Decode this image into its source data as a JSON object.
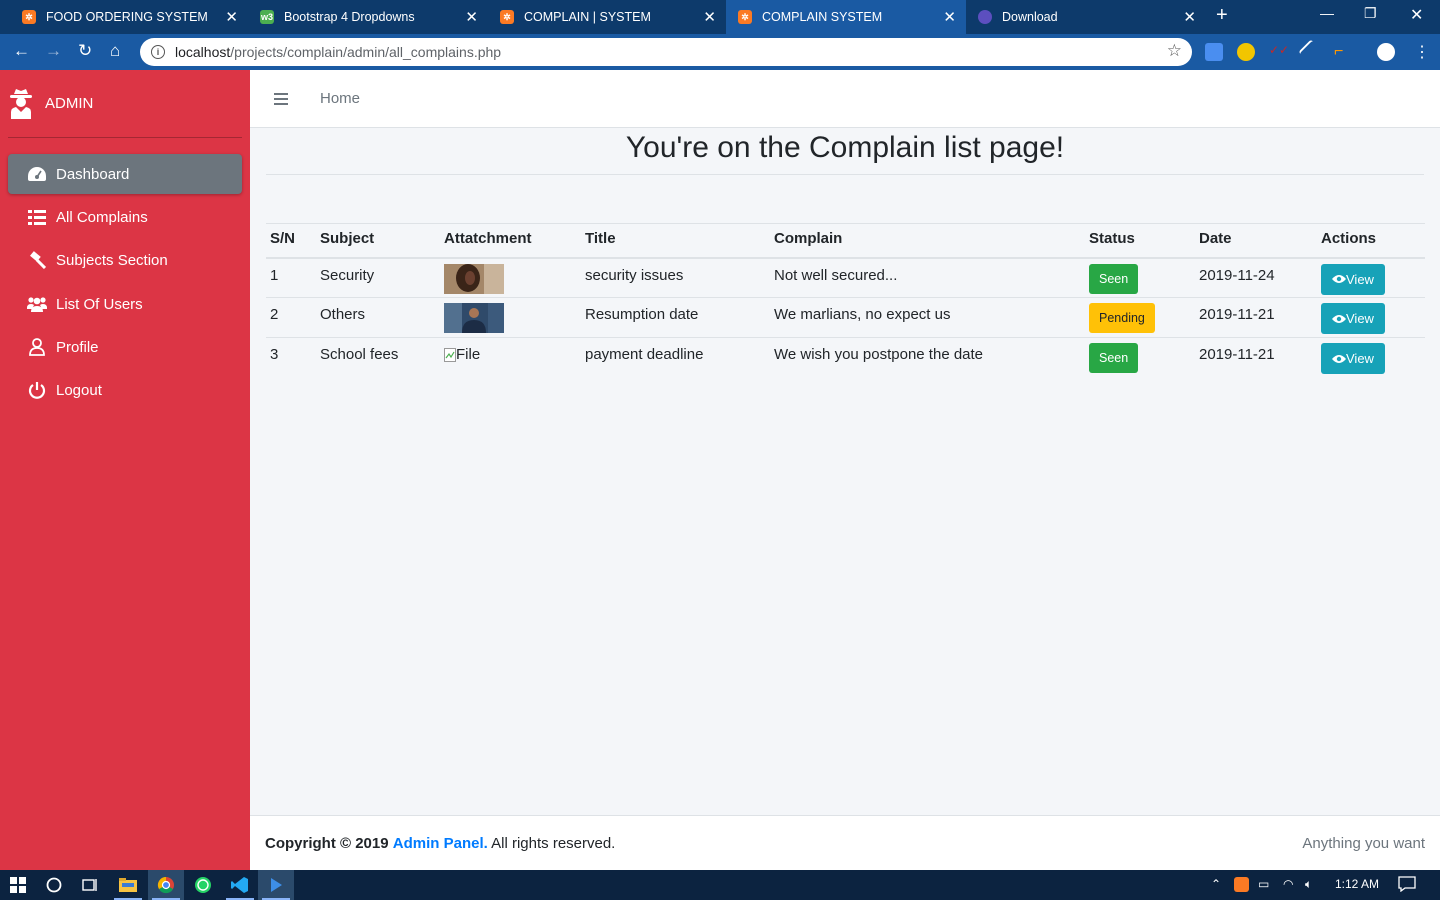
{
  "browser": {
    "tabs": [
      {
        "title": "FOOD ORDERING SYSTEM",
        "favicon": "xampp-icon",
        "active": false
      },
      {
        "title": "Bootstrap 4 Dropdowns",
        "favicon": "w3-icon",
        "active": false
      },
      {
        "title": "COMPLAIN | SYSTEM",
        "favicon": "xampp-icon",
        "active": false
      },
      {
        "title": "COMPLAIN SYSTEM",
        "favicon": "xampp-icon",
        "active": true
      },
      {
        "title": "Download",
        "favicon": "globe-icon",
        "active": false
      }
    ],
    "url_host": "localhost",
    "url_path": "/projects/complain/admin/all_complains.php"
  },
  "sidebar": {
    "brand": "ADMIN",
    "items": [
      {
        "label": "Dashboard",
        "icon": "tachometer-icon",
        "active": true
      },
      {
        "label": "All Complains",
        "icon": "list-icon",
        "active": false
      },
      {
        "label": "Subjects Section",
        "icon": "gavel-icon",
        "active": false
      },
      {
        "label": "List Of Users",
        "icon": "users-icon",
        "active": false
      },
      {
        "label": "Profile",
        "icon": "user-icon",
        "active": false
      },
      {
        "label": "Logout",
        "icon": "power-icon",
        "active": false
      }
    ]
  },
  "topnav": {
    "home": "Home"
  },
  "page": {
    "title": "You're on the Complain list page!"
  },
  "table": {
    "headers": [
      "S/N",
      "Subject",
      "Attatchment",
      "Title",
      "Complain",
      "Status",
      "Date",
      "Actions"
    ],
    "rows": [
      {
        "sn": "1",
        "subject": "Security",
        "attachment": "image",
        "title": "security issues",
        "complain": "Not well secured...",
        "status": "Seen",
        "date": "2019-11-24",
        "action": "View"
      },
      {
        "sn": "2",
        "subject": "Others",
        "attachment": "image",
        "title": "Resumption date",
        "complain": "We marlians, no expect us",
        "status": "Pending",
        "date": "2019-11-21",
        "action": "View"
      },
      {
        "sn": "3",
        "subject": "School fees",
        "attachment": "File",
        "title": "payment deadline",
        "complain": "We wish you postpone the date",
        "status": "Seen",
        "date": "2019-11-21",
        "action": "View"
      }
    ]
  },
  "footer": {
    "copyright_prefix": "Copyright © 2019",
    "brand": "Admin Panel.",
    "suffix": "All rights reserved.",
    "right": "Anything you want"
  },
  "taskbar": {
    "time": "1:12 AM"
  },
  "colors": {
    "sidebar": "#dc3545",
    "active_nav": "#6c757d",
    "seen": "#28a745",
    "pending": "#ffc107",
    "view": "#17a2b8",
    "link": "#007bff"
  }
}
